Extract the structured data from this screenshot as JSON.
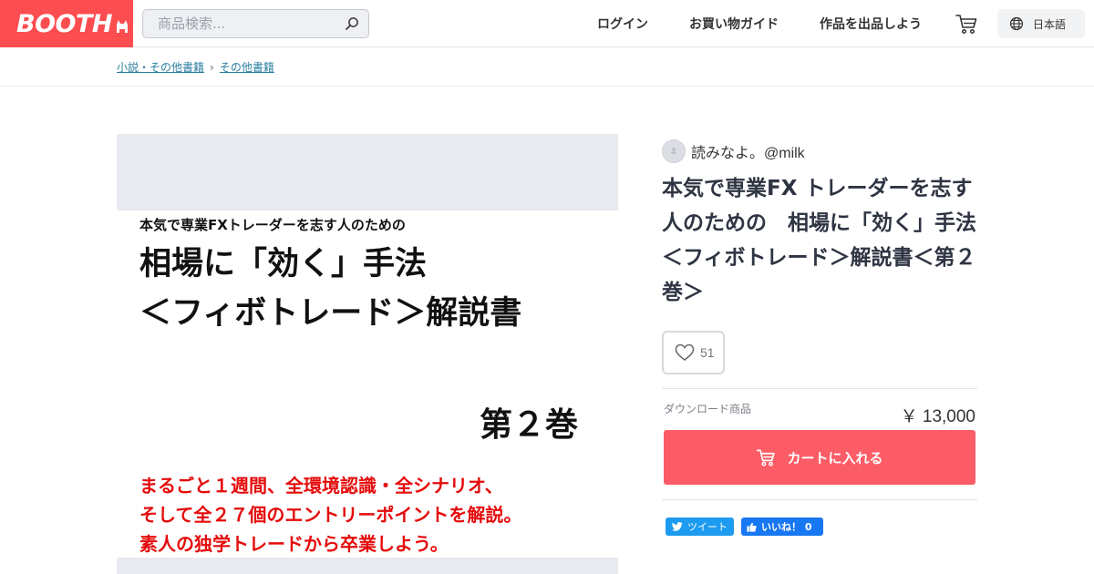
{
  "colors": {
    "brand": "#fc4d50",
    "cart_button": "#fc5c66",
    "link": "#2b7fa0",
    "twitter": "#1d9bf0",
    "facebook": "#1877f2"
  },
  "header": {
    "logo": "BOOTH",
    "search_placeholder": "商品検索...",
    "nav": {
      "login": "ログイン",
      "guide": "お買い物ガイド",
      "sell": "作品を出品しよう"
    },
    "language": "日本語"
  },
  "icons": {
    "search": "search-icon",
    "cart": "cart-icon",
    "globe": "globe-icon",
    "heart": "heart-icon",
    "twitter": "twitter-bird-icon",
    "facebook_like": "thumbs-up-icon"
  },
  "breadcrumb": [
    "小説・その他書籍",
    "その他書籍"
  ],
  "image": {
    "subtitle": "本気で専業FXトレーダーを志す人のための",
    "title_line1": "相場に「効く」手法",
    "title_line2": "＜フィボトレード＞解説書",
    "volume": "第２巻",
    "red_lines": [
      "まるごと１週間、全環境認識・全シナリオ、",
      "そして全２７個のエントリーポイントを解説。",
      "素人の独学トレードから卒業しよう。"
    ]
  },
  "product": {
    "shop_name": "読みなよ。@milk",
    "title": "本気で専業FX トレーダーを志す人のための　相場に「効く」手法＜フィボトレード＞解説書＜第２巻＞",
    "likes": "51",
    "variant": "ダウンロード商品",
    "price": "￥ 13,000",
    "cart_label": "カートに入れる"
  },
  "share": {
    "tweet": "ツイート",
    "fb_like": "いいね！ 0"
  }
}
